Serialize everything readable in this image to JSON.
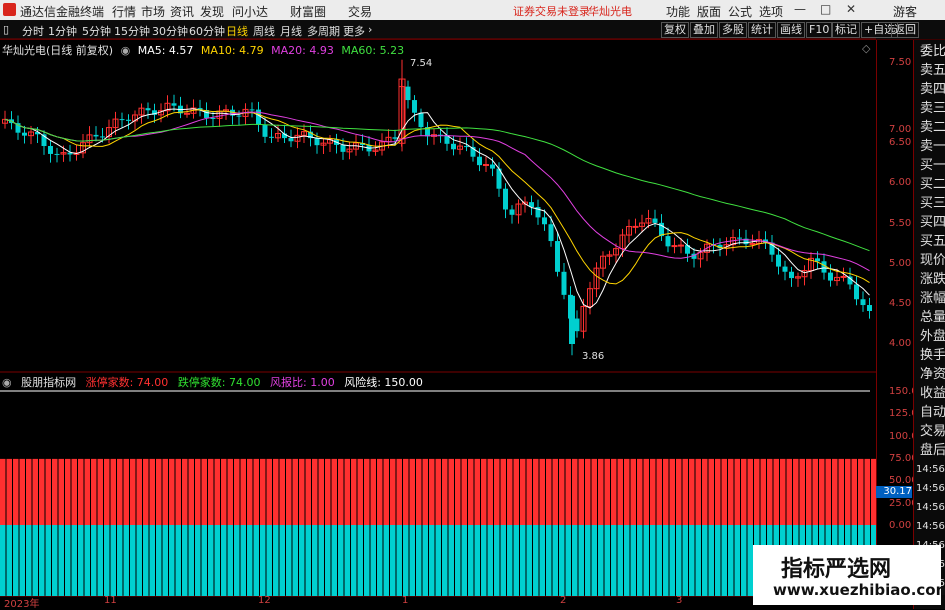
{
  "menubar": {
    "app_name": "通达信金融终端",
    "menus": [
      "行情",
      "市场",
      "资讯",
      "发现",
      "问小达",
      "财富圈",
      "交易"
    ],
    "notice": "证券交易未登录",
    "stock_name": "华灿光电",
    "right_menus": [
      "功能",
      "版面",
      "公式",
      "选项"
    ],
    "guest": "游客"
  },
  "tabbar": {
    "periods": [
      "分时",
      "1分钟",
      "5分钟",
      "15分钟",
      "30分钟",
      "60分钟",
      "日线",
      "周线",
      "月线",
      "多周期",
      "更多"
    ],
    "active_period": "日线",
    "right_buttons": [
      "复权",
      "叠加",
      "多股",
      "统计",
      "画线",
      "F10",
      "标记",
      "+自选",
      "返回"
    ]
  },
  "main_chart": {
    "title": "华灿光电(日线 前复权)",
    "ma": [
      {
        "label": "MA5: 4.57",
        "color": "#ffffff"
      },
      {
        "label": "MA10: 4.79",
        "color": "#ffd400"
      },
      {
        "label": "MA20: 4.93",
        "color": "#e040e0"
      },
      {
        "label": "MA60: 5.23",
        "color": "#40e040"
      }
    ],
    "price_ticks": [
      "7.50",
      "7.00",
      "6.50",
      "6.00",
      "5.50",
      "5.00",
      "4.50",
      "4.00"
    ],
    "high_label": "7.54",
    "low_label": "3.86",
    "dates": [
      "2023年",
      "11",
      "12",
      "1",
      "2",
      "3"
    ]
  },
  "indicator": {
    "name": "股朋指标网",
    "items": [
      {
        "label": "涨停家数: 74.00",
        "color": "#ff3030"
      },
      {
        "label": "跌停家数: 74.00",
        "color": "#30e030"
      },
      {
        "label": "风报比: 1.00",
        "color": "#e040e0"
      },
      {
        "label": "风险线: 150.00",
        "color": "#ffffff"
      }
    ],
    "ticks": [
      "150.0",
      "125.0",
      "100.0",
      "75.00",
      "50.00",
      "25.00",
      "0.00"
    ],
    "cursor_value": "30.17"
  },
  "side_panel": {
    "labels": [
      "委比",
      "卖五",
      "卖四",
      "卖三",
      "卖二",
      "卖一",
      "买一",
      "买二",
      "买三",
      "买四",
      "买五",
      "现价",
      "涨跌",
      "涨幅",
      "总量",
      "外盘",
      "换手",
      "净资",
      "收益",
      "自动",
      "交易",
      "盘后",
      "14:56",
      "14:56",
      "14:56",
      "14:56",
      "14:56",
      "14:56",
      "14:56"
    ]
  },
  "watermark": {
    "line1": "指标严选网",
    "line2": "www.xuezhibiao.com"
  },
  "colors": {
    "up": "#ff3030",
    "down": "#00d0d0",
    "accent": "#d04040"
  }
}
